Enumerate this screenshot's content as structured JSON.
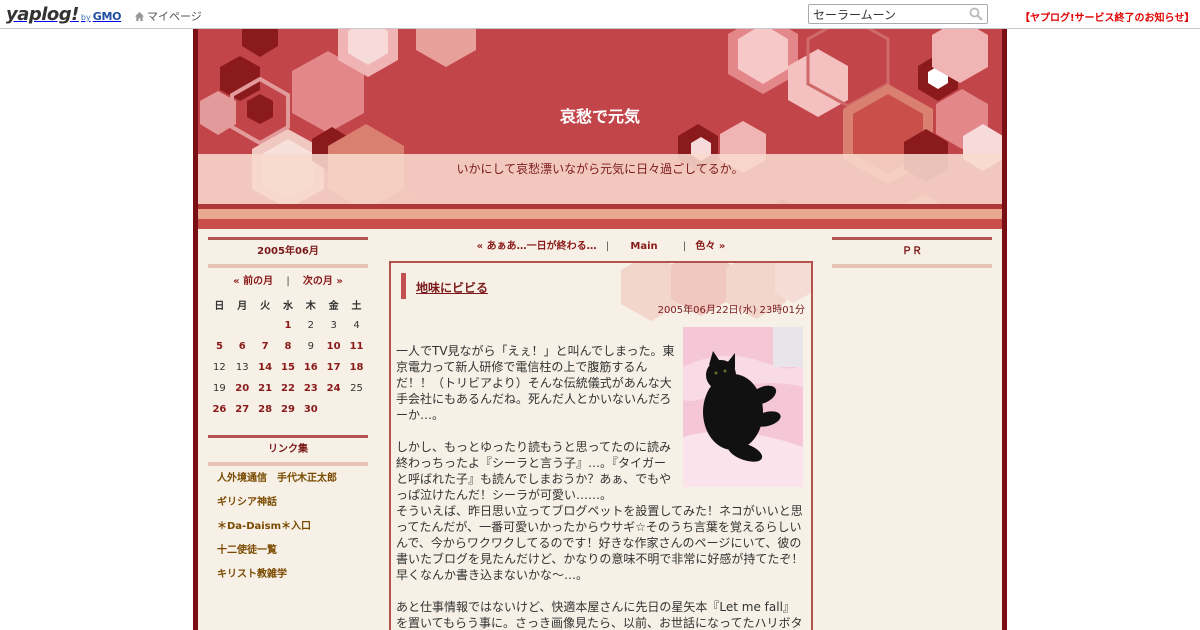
{
  "topbar": {
    "logo_main": "yaplog!",
    "logo_by": "by",
    "logo_gmo": "GMO",
    "mypage_label": "マイページ",
    "search_value": "セーラームーン",
    "notice_label": "【ヤプログ!サービス終了のお知らせ】"
  },
  "blog": {
    "title": "哀愁で元気",
    "description": "いかにして哀愁漂いながら元気に日々過ごしてるか。"
  },
  "calendar": {
    "title": "2005年06月",
    "prev_label": "« 前の月",
    "next_label": "次の月 »",
    "separator": "|",
    "weekdays": [
      "日",
      "月",
      "火",
      "水",
      "木",
      "金",
      "土"
    ],
    "weeks": [
      [
        "",
        "",
        "",
        "1",
        "2",
        "3",
        "4"
      ],
      [
        "5",
        "6",
        "7",
        "8",
        "9",
        "10",
        "11"
      ],
      [
        "12",
        "13",
        "14",
        "15",
        "16",
        "17",
        "18"
      ],
      [
        "19",
        "20",
        "21",
        "22",
        "23",
        "24",
        "25"
      ],
      [
        "26",
        "27",
        "28",
        "29",
        "30",
        "",
        ""
      ]
    ],
    "linked_days": [
      "1",
      "5",
      "6",
      "7",
      "8",
      "10",
      "11",
      "14",
      "15",
      "16",
      "17",
      "18",
      "20",
      "21",
      "22",
      "23",
      "24",
      "26",
      "27",
      "28",
      "29",
      "30"
    ]
  },
  "links": {
    "title": "リンク集",
    "items": [
      "人外境通信　手代木正太郎",
      "ギリシア神話",
      "＊Da-Daism＊入口",
      "十二使徒一覧",
      "キリスト教雑学"
    ]
  },
  "nav": {
    "prev_label": "« あぁあ…一日が終わる…",
    "main_label": "Main",
    "next_label": "色々 »",
    "separator": "|"
  },
  "entry": {
    "title": "地味にビビる",
    "date": "2005年06月22日(水) 23時01分",
    "para1": "一人でTV見ながら「えぇ！」と叫んでしまった。東京電力って新人研修で電信柱の上で腹筋するんだ！！（トリビアより）そんな伝統儀式があんな大手会社にもあるんだね。死んだ人とかいないんだろーか…。",
    "para2": "しかし、もっとゆったり読もうと思ってたのに読み終わっちったよ『シーラと言う子』…。『タイガーと呼ばれた子』も読んでしまおうか？あぁ、でもやっぱ泣けたんだ！シーラが可愛い……。",
    "para3": "そういえば、昨日思い立ってブログペットを設置してみた！ネコがいいと思ってたんだが、一番可愛いかったからウサギ☆そのうち言葉を覚えるらしいんで、今からワクワクしてるのです！好きな作家さんのページにいて、彼の書いたブログを見たんだけど、かなりの意味不明で非常に好感が持てたぞ！早くなんか書き込まないかな～…。",
    "para4": "あと仕事情報ではないけど、快適本屋さんに先日の星矢本『Let me fall』を置いてもらう事に。さっき画像見たら、以前、お世話になってたハリボタ本"
  },
  "pr": {
    "title": "ＰＲ"
  },
  "colors": {
    "frame": "#7a0f14",
    "header": "#c2454a",
    "accent": "#b3534f",
    "content_bg": "#f6f0e6",
    "link": "#8a1a1a",
    "notice": "#e00000"
  },
  "icons": [
    "house-icon",
    "magnifier-icon",
    "black-cat-photo"
  ]
}
